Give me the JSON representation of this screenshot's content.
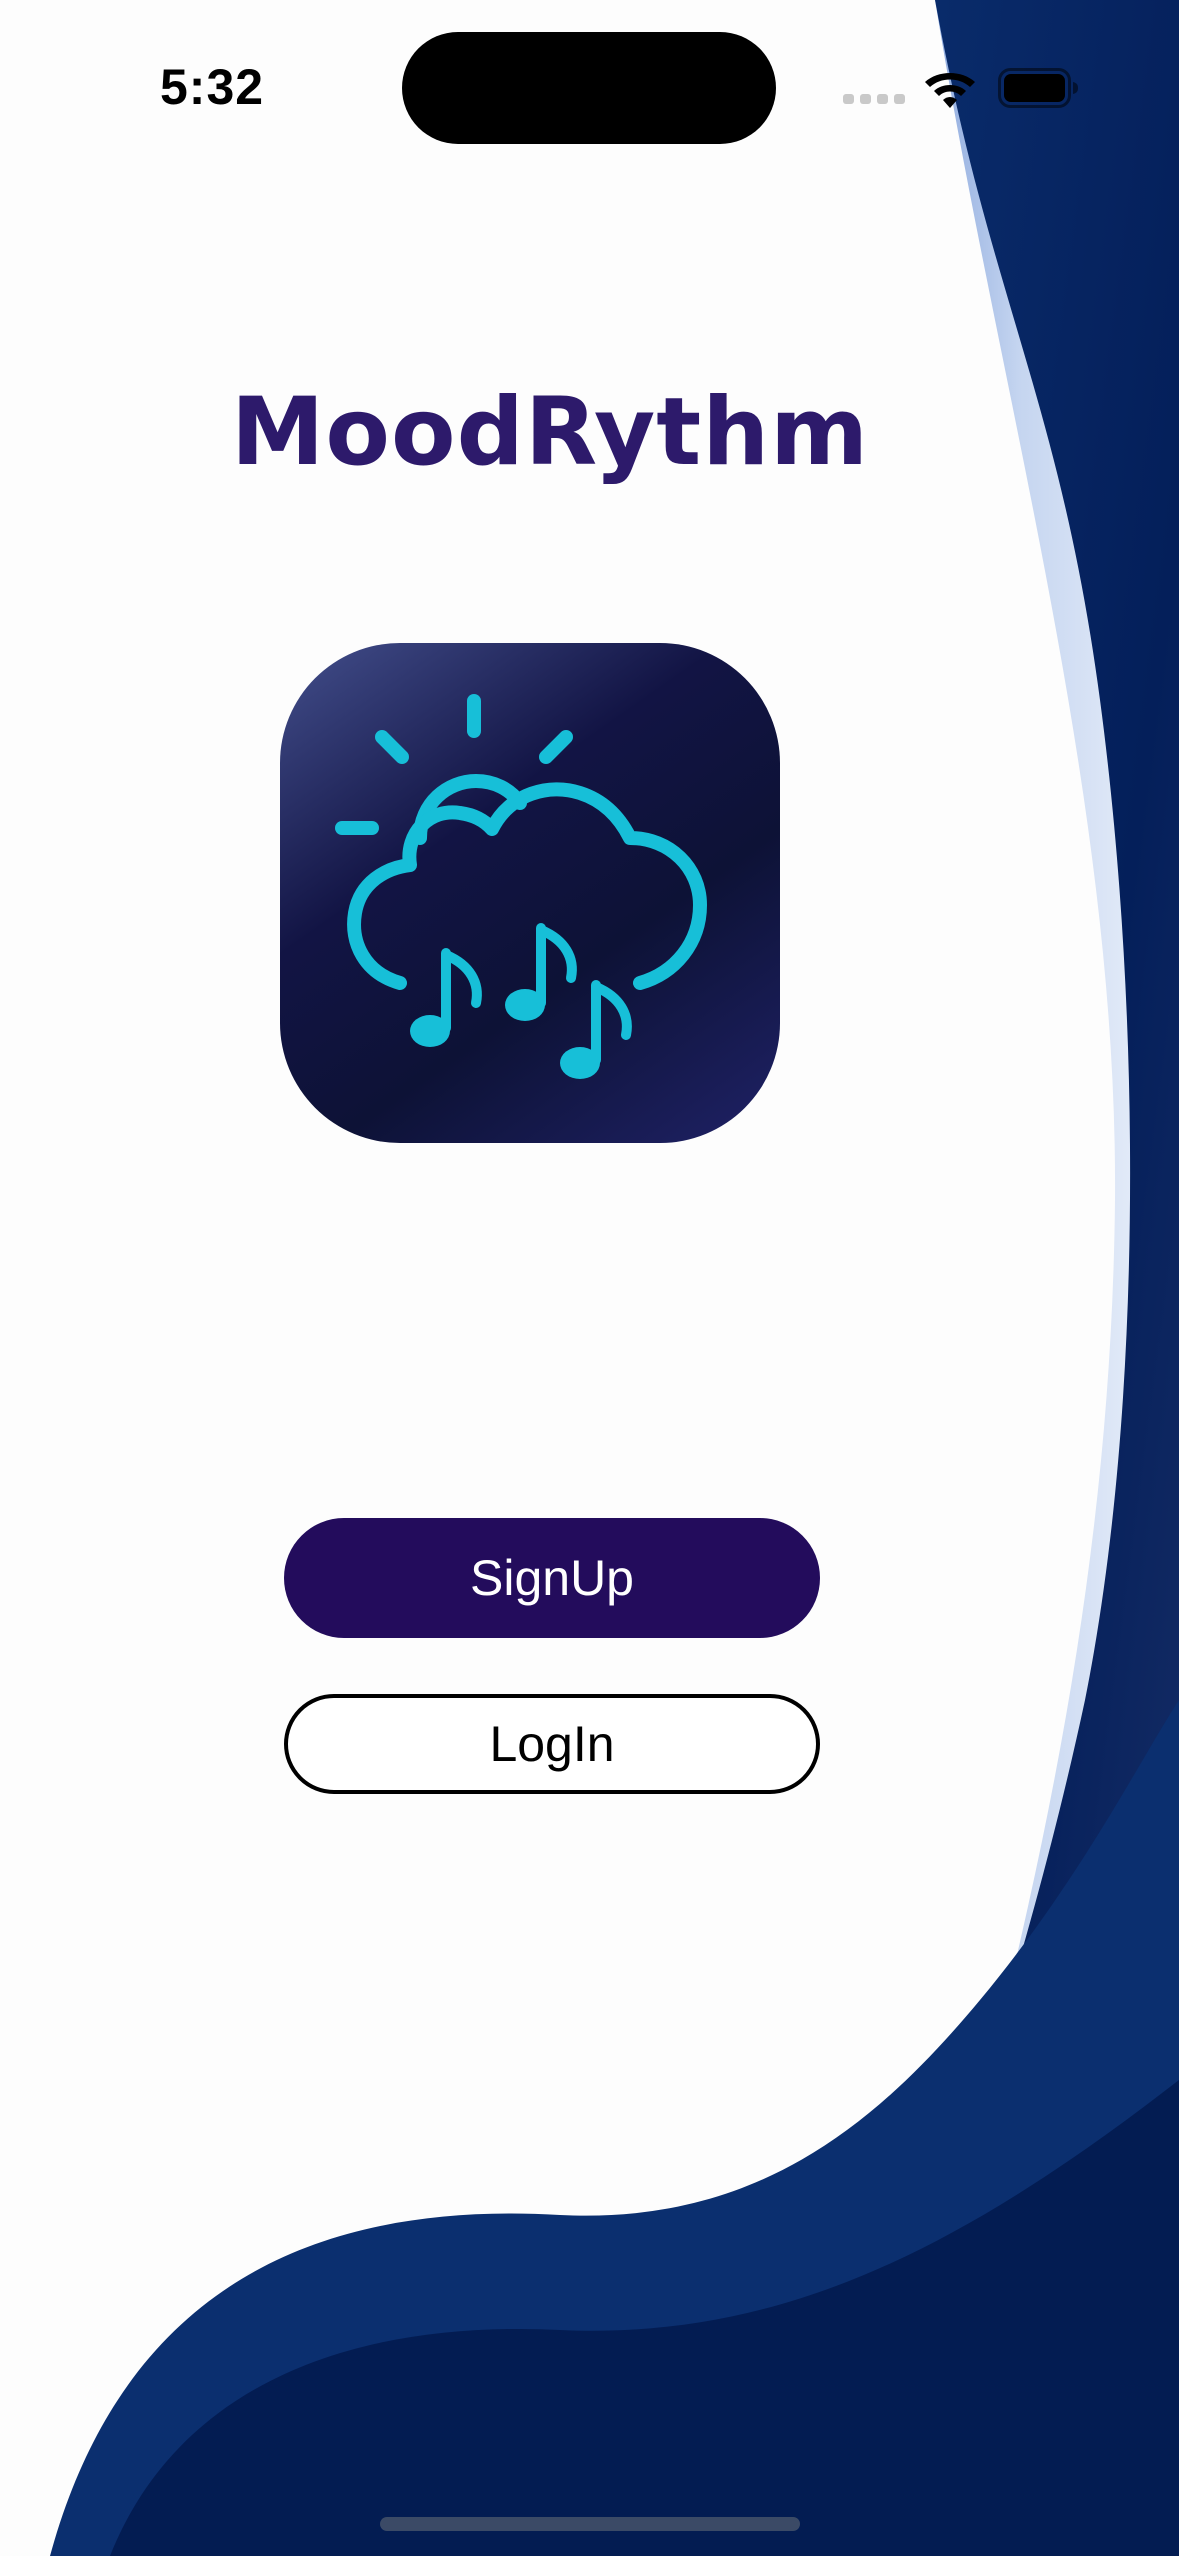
{
  "status_bar": {
    "time": "5:32"
  },
  "app": {
    "title": "MoodRythm",
    "logo_icon": "cloud-sun-music-notes-icon"
  },
  "buttons": {
    "signup_label": "SignUp",
    "login_label": "LogIn"
  },
  "colors": {
    "title": "#2d1a6b",
    "signup_bg": "#230c5c",
    "wave_dark": "#04215e",
    "icon_cyan": "#17bfd8",
    "logo_bg": "#121444"
  }
}
